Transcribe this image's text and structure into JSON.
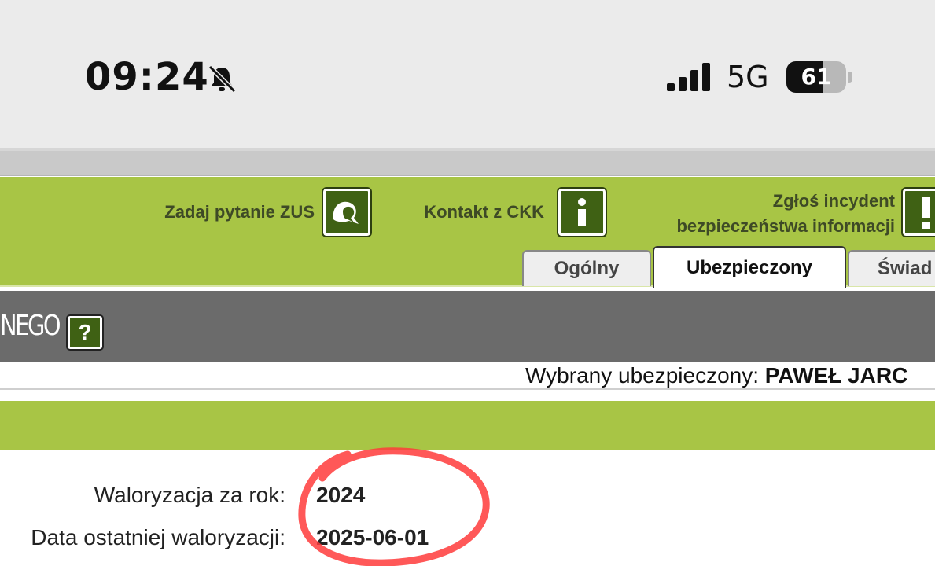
{
  "status_bar": {
    "time": "09:24",
    "network": "5G",
    "battery": "61",
    "battery_level_percent": 61,
    "icons": [
      "bell-slash-icon",
      "cellular-signal-icon",
      "battery-icon"
    ]
  },
  "header": {
    "links": [
      {
        "label": "Zadaj pytanie ZUS",
        "icon": "chat-bubbles-icon"
      },
      {
        "label": "Kontakt z CKK",
        "icon": "info-icon"
      },
      {
        "label_line1": "Zgłoś incydent",
        "label_line2": "bezpieczeństwa informacji",
        "icon": "exclamation-icon"
      }
    ],
    "tabs": [
      {
        "label": "Ogólny",
        "active": false
      },
      {
        "label": "Ubezpieczony",
        "active": true
      },
      {
        "label": "Świad",
        "active": false
      }
    ],
    "accent_color": "#a8c545",
    "icon_color": "#3f6114"
  },
  "section": {
    "title": "NEGO",
    "help_label": "?"
  },
  "selected": {
    "label": "Wybrany ubezpieczony:",
    "name": "PAWEŁ JARC"
  },
  "details": [
    {
      "label": "Waloryzacja za rok:",
      "value": "2024"
    },
    {
      "label": "Data ostatniej waloryzacji:",
      "value": "2025-06-01"
    }
  ],
  "annotation_color": "#ff3b3b"
}
